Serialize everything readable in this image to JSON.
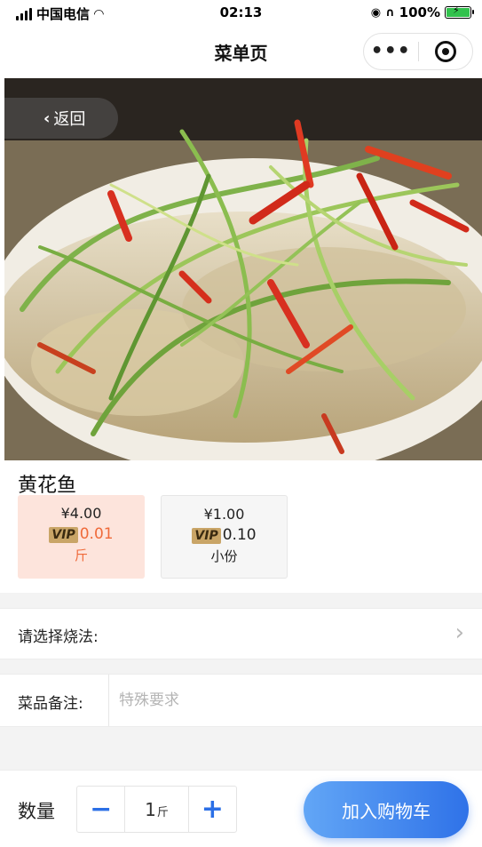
{
  "status_bar": {
    "carrier": "中国电信",
    "time": "02:13",
    "battery": "100%"
  },
  "nav": {
    "title": "菜单页",
    "more_icon": "more-dots-icon",
    "close_icon": "target-close-icon"
  },
  "hero": {
    "back_label": "返回",
    "back_icon": "chevron-left-icon"
  },
  "dish": {
    "name": "黄花鱼",
    "specs": [
      {
        "price": "¥4.00",
        "vip_tag": "VIP",
        "vip_price": "0.01",
        "unit": "斤",
        "selected": true
      },
      {
        "price": "¥1.00",
        "vip_tag": "VIP",
        "vip_price": "0.10",
        "unit": "小份",
        "selected": false
      }
    ]
  },
  "cooking": {
    "label": "请选择烧法:",
    "arrow_icon": "chevron-right-icon"
  },
  "note": {
    "label": "菜品备注:",
    "placeholder": "特殊要求",
    "value": ""
  },
  "bottom": {
    "qty_label": "数量",
    "minus": "−",
    "qty_value": "1",
    "qty_unit": "斤",
    "plus": "+",
    "add_to_cart": "加入购物车"
  },
  "colors": {
    "accent_blue": "#2f72e8",
    "vip_gold": "#c9a567",
    "selected_spec_bg": "#fde4dc",
    "selected_spec_text": "#ef6a3a"
  }
}
